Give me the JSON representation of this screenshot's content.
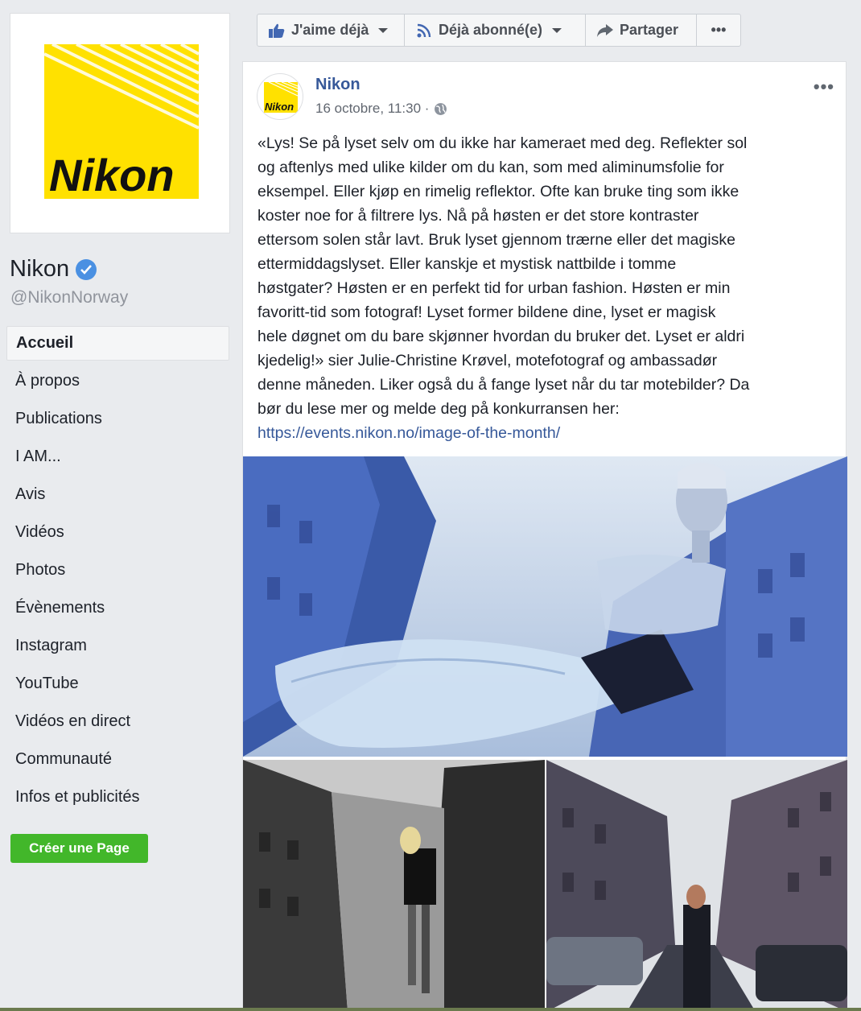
{
  "sidebar": {
    "page_name": "Nikon",
    "page_handle": "@NikonNorway",
    "logo_text": "Nikon",
    "nav_items": [
      {
        "label": "Accueil"
      },
      {
        "label": "À propos"
      },
      {
        "label": "Publications"
      },
      {
        "label": "I AM..."
      },
      {
        "label": "Avis"
      },
      {
        "label": "Vidéos"
      },
      {
        "label": "Photos"
      },
      {
        "label": "Évènements"
      },
      {
        "label": "Instagram"
      },
      {
        "label": "YouTube"
      },
      {
        "label": "Vidéos en direct"
      },
      {
        "label": "Communauté"
      },
      {
        "label": "Infos et publicités"
      }
    ],
    "create_page_label": "Créer une Page"
  },
  "action_bar": {
    "like_label": "J'aime déjà",
    "follow_label": "Déjà abonné(e)",
    "share_label": "Partager",
    "more_label": "•••"
  },
  "post": {
    "author": "Nikon",
    "timestamp": "16 octobre, 11:30 ·",
    "menu_label": "•••",
    "avatar_logo_text": "Nikon",
    "text": "«Lys! Se på lyset selv om du ikke har kameraet med deg. Reflekter sol\nog aftenlys med ulike kilder om du kan, som med aliminumsfolie for\neksempel. Eller kjøp en rimelig reflektor. Ofte kan bruke ting som ikke\nkoster noe for å filtrere lys. Nå på høsten er det store kontraster\nettersom solen står lavt. Bruk lyset gjennom trærne eller det magiske\nettermiddagslyset. Eller kanskje et mystisk nattbilde i tomme\nhøstgater? Høsten er en perfekt tid for urban fashion. Høsten er min\nfavoritt-tid som fotograf! Lyset former bildene dine, lyset er magisk\nhele døgnet om du bare skjønner hvordan du bruker det. Lyset er aldri\nkjedelig!» sier Julie-Christine Krøvel, motefotograf og ambassadør\ndenne måneden. Liker også du å fange lyset når du tar motebilder? Da\nbør du lese mer og melde deg på konkurransen her:",
    "link": "https://events.nikon.no/image-of-the-month/"
  },
  "colors": {
    "brand_yellow": "#ffe100",
    "link_blue": "#365899",
    "verified_blue": "#4a90e2",
    "create_green": "#42b72a"
  }
}
